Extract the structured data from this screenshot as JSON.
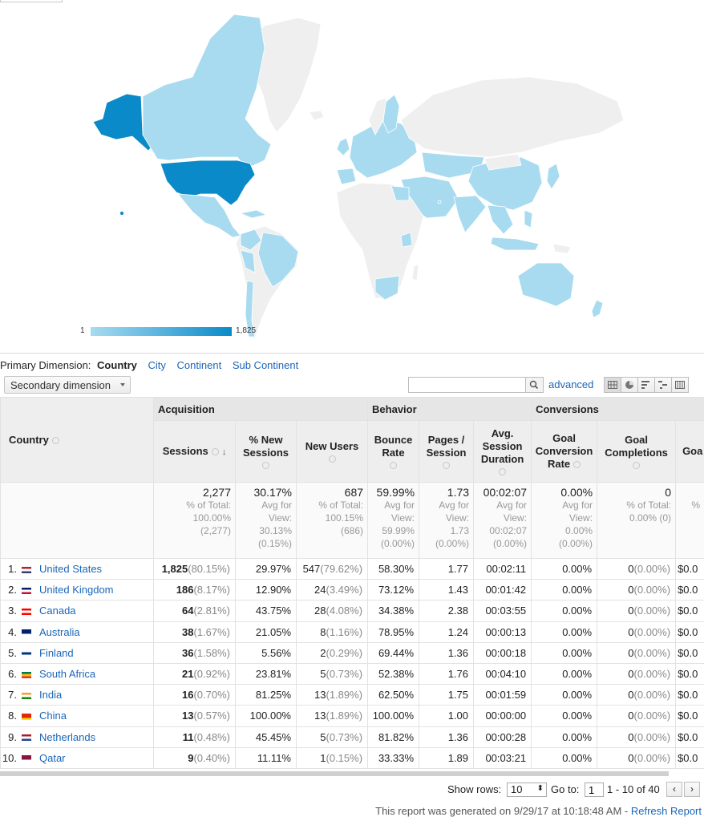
{
  "map": {
    "legend_min": "1",
    "legend_max": "1,825",
    "colors": {
      "high": "#0a8ac9",
      "low": "#a8dbf0",
      "nodata": "#efefef",
      "border": "#ffffff"
    }
  },
  "dimension_bar": {
    "label": "Primary Dimension:",
    "current": "Country",
    "options": [
      "City",
      "Continent",
      "Sub Continent"
    ]
  },
  "toolbar": {
    "secondary_dimension": "Secondary dimension",
    "search_placeholder": "",
    "advanced": "advanced",
    "view_icons": [
      "data-table-icon",
      "pie-icon",
      "performance-icon",
      "comparison-icon",
      "pivot-icon"
    ]
  },
  "table": {
    "groups": {
      "acquisition": "Acquisition",
      "behavior": "Behavior",
      "conversions": "Conversions"
    },
    "headers": {
      "country": "Country",
      "sessions": "Sessions",
      "new_sessions": "% New Sessions",
      "new_users": "New Users",
      "bounce": "Bounce Rate",
      "pages": "Pages / Session",
      "duration": "Avg. Session Duration",
      "gcr": "Goal Conversion Rate",
      "gc": "Goal Completions",
      "gv": "Goa"
    },
    "totals": {
      "sessions": {
        "value": "2,277",
        "l1": "% of Total:",
        "l2": "100.00%",
        "l3": "(2,277)"
      },
      "new_sessions": {
        "value": "30.17%",
        "l1": "Avg for",
        "l2": "View:",
        "l3": "30.13%",
        "l4": "(0.15%)"
      },
      "new_users": {
        "value": "687",
        "l1": "% of Total:",
        "l2": "100.15%",
        "l3": "(686)"
      },
      "bounce": {
        "value": "59.99%",
        "l1": "Avg for",
        "l2": "View:",
        "l3": "59.99%",
        "l4": "(0.00%)"
      },
      "pages": {
        "value": "1.73",
        "l1": "Avg for",
        "l2": "View:",
        "l3": "1.73",
        "l4": "(0.00%)"
      },
      "duration": {
        "value": "00:02:07",
        "l1": "Avg for",
        "l2": "View:",
        "l3": "00:02:07",
        "l4": "(0.00%)"
      },
      "gcr": {
        "value": "0.00%",
        "l1": "Avg for",
        "l2": "View:",
        "l3": "0.00%",
        "l4": "(0.00%)"
      },
      "gc": {
        "value": "0",
        "l1": "% of Total:",
        "l2": "0.00% (0)"
      },
      "gv": {
        "l1": "%"
      }
    },
    "rows": [
      {
        "num": "1.",
        "country": "United States",
        "sessions": "1,825",
        "sessions_pct": "(80.15%)",
        "new_sessions": "29.97%",
        "new_users": "547",
        "new_users_pct": "(79.62%)",
        "bounce": "58.30%",
        "pages": "1.77",
        "duration": "00:02:11",
        "gcr": "0.00%",
        "gc": "0",
        "gc_pct": "(0.00%)",
        "gv": "$0.0",
        "flag": "us"
      },
      {
        "num": "2.",
        "country": "United Kingdom",
        "sessions": "186",
        "sessions_pct": "(8.17%)",
        "new_sessions": "12.90%",
        "new_users": "24",
        "new_users_pct": "(3.49%)",
        "bounce": "73.12%",
        "pages": "1.43",
        "duration": "00:01:42",
        "gcr": "0.00%",
        "gc": "0",
        "gc_pct": "(0.00%)",
        "gv": "$0.0",
        "flag": "gb"
      },
      {
        "num": "3.",
        "country": "Canada",
        "sessions": "64",
        "sessions_pct": "(2.81%)",
        "new_sessions": "43.75%",
        "new_users": "28",
        "new_users_pct": "(4.08%)",
        "bounce": "34.38%",
        "pages": "2.38",
        "duration": "00:03:55",
        "gcr": "0.00%",
        "gc": "0",
        "gc_pct": "(0.00%)",
        "gv": "$0.0",
        "flag": "ca"
      },
      {
        "num": "4.",
        "country": "Australia",
        "sessions": "38",
        "sessions_pct": "(1.67%)",
        "new_sessions": "21.05%",
        "new_users": "8",
        "new_users_pct": "(1.16%)",
        "bounce": "78.95%",
        "pages": "1.24",
        "duration": "00:00:13",
        "gcr": "0.00%",
        "gc": "0",
        "gc_pct": "(0.00%)",
        "gv": "$0.0",
        "flag": "au"
      },
      {
        "num": "5.",
        "country": "Finland",
        "sessions": "36",
        "sessions_pct": "(1.58%)",
        "new_sessions": "5.56%",
        "new_users": "2",
        "new_users_pct": "(0.29%)",
        "bounce": "69.44%",
        "pages": "1.36",
        "duration": "00:00:18",
        "gcr": "0.00%",
        "gc": "0",
        "gc_pct": "(0.00%)",
        "gv": "$0.0",
        "flag": "fi"
      },
      {
        "num": "6.",
        "country": "South Africa",
        "sessions": "21",
        "sessions_pct": "(0.92%)",
        "new_sessions": "23.81%",
        "new_users": "5",
        "new_users_pct": "(0.73%)",
        "bounce": "52.38%",
        "pages": "1.76",
        "duration": "00:04:10",
        "gcr": "0.00%",
        "gc": "0",
        "gc_pct": "(0.00%)",
        "gv": "$0.0",
        "flag": "za"
      },
      {
        "num": "7.",
        "country": "India",
        "sessions": "16",
        "sessions_pct": "(0.70%)",
        "new_sessions": "81.25%",
        "new_users": "13",
        "new_users_pct": "(1.89%)",
        "bounce": "62.50%",
        "pages": "1.75",
        "duration": "00:01:59",
        "gcr": "0.00%",
        "gc": "0",
        "gc_pct": "(0.00%)",
        "gv": "$0.0",
        "flag": "in"
      },
      {
        "num": "8.",
        "country": "China",
        "sessions": "13",
        "sessions_pct": "(0.57%)",
        "new_sessions": "100.00%",
        "new_users": "13",
        "new_users_pct": "(1.89%)",
        "bounce": "100.00%",
        "pages": "1.00",
        "duration": "00:00:00",
        "gcr": "0.00%",
        "gc": "0",
        "gc_pct": "(0.00%)",
        "gv": "$0.0",
        "flag": "cn"
      },
      {
        "num": "9.",
        "country": "Netherlands",
        "sessions": "11",
        "sessions_pct": "(0.48%)",
        "new_sessions": "45.45%",
        "new_users": "5",
        "new_users_pct": "(0.73%)",
        "bounce": "81.82%",
        "pages": "1.36",
        "duration": "00:00:28",
        "gcr": "0.00%",
        "gc": "0",
        "gc_pct": "(0.00%)",
        "gv": "$0.0",
        "flag": "nl"
      },
      {
        "num": "10.",
        "country": "Qatar",
        "sessions": "9",
        "sessions_pct": "(0.40%)",
        "new_sessions": "11.11%",
        "new_users": "1",
        "new_users_pct": "(0.15%)",
        "bounce": "33.33%",
        "pages": "1.89",
        "duration": "00:03:21",
        "gcr": "0.00%",
        "gc": "0",
        "gc_pct": "(0.00%)",
        "gv": "$0.0",
        "flag": "qa"
      }
    ]
  },
  "footer": {
    "show_rows_label": "Show rows:",
    "show_rows_value": "10",
    "goto_label": "Go to:",
    "goto_value": "1",
    "range": "1 - 10 of 40",
    "prev": "‹",
    "next": "›",
    "report_text": "This report was generated on 9/29/17 at 10:18:48 AM - ",
    "refresh": "Refresh Report"
  }
}
